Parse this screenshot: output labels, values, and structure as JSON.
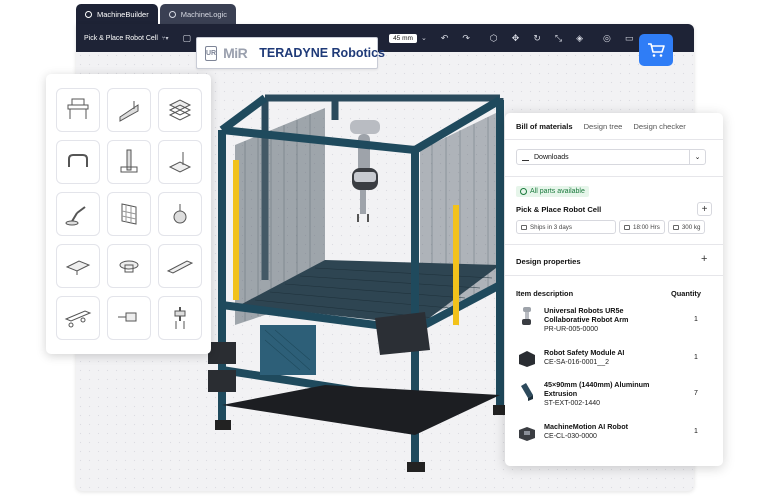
{
  "tabs": [
    {
      "label": "MachineBuilder",
      "active": true
    },
    {
      "label": "MachineLogic",
      "active": false
    }
  ],
  "toolbar": {
    "project_name": "Pick & Place Robot Cell",
    "dimension_value": "45 mm",
    "icons": [
      "branch-icon",
      "comment-icon",
      "undo-icon",
      "redo-icon",
      "cube-icon",
      "transform-icon",
      "collapse-icon",
      "layers-icon",
      "check-circle-icon",
      "chat-icon",
      "settings-icon"
    ]
  },
  "logo": {
    "ur": "UR",
    "mir": "MiR",
    "teradyne": "TERADYNE Robotics"
  },
  "cart": {
    "icon": "shopping-cart-icon",
    "color": "#2f7df6"
  },
  "palette": {
    "items": [
      "workbench-icon",
      "angle-bracket-icon",
      "stacked-plates-icon",
      "handle-icon",
      "vertical-actuator-icon",
      "sensor-plate-icon",
      "robot-arm-icon",
      "mesh-panel-icon",
      "caster-wheel-icon",
      "linear-actuator-icon",
      "rotary-table-icon",
      "conveyor-rail-icon",
      "track-carriage-icon",
      "motor-icon",
      "gripper-icon"
    ]
  },
  "bom": {
    "tabs": [
      "Bill of materials",
      "Design tree",
      "Design checker"
    ],
    "downloads_label": "Downloads",
    "availability": "All parts available",
    "project_name": "Pick & Place Robot Cell",
    "chips": {
      "shipping": "Ships in 3 days",
      "hours": "18:00 Hrs",
      "weight": "300 kg"
    },
    "design_properties": "Design properties",
    "col_item": "Item description",
    "col_qty": "Quantity",
    "items": [
      {
        "name": "Universal Robots UR5e Collaborative Robot Arm",
        "code": "PR-UR-005-0000",
        "qty": "1",
        "thumb": "robot-arm-thumb-icon"
      },
      {
        "name": "Robot Safety Module AI",
        "code": "CE-SA-016-0001__2",
        "qty": "1",
        "thumb": "safety-module-thumb-icon"
      },
      {
        "name": "45×90mm (1440mm) Aluminum Extrusion",
        "code": "ST-EXT-002-1440",
        "qty": "7",
        "thumb": "extrusion-thumb-icon"
      },
      {
        "name": "MachineMotion AI Robot",
        "code": "CE-CL-030-0000",
        "qty": "1",
        "thumb": "controller-thumb-icon"
      }
    ]
  },
  "colors": {
    "toolbar_bg": "#1e2336",
    "frame": "#2d4a5c",
    "accent_blue": "#2f7df6",
    "light_curtain": "#f2c21b",
    "available_green": "#1a7a3c"
  }
}
